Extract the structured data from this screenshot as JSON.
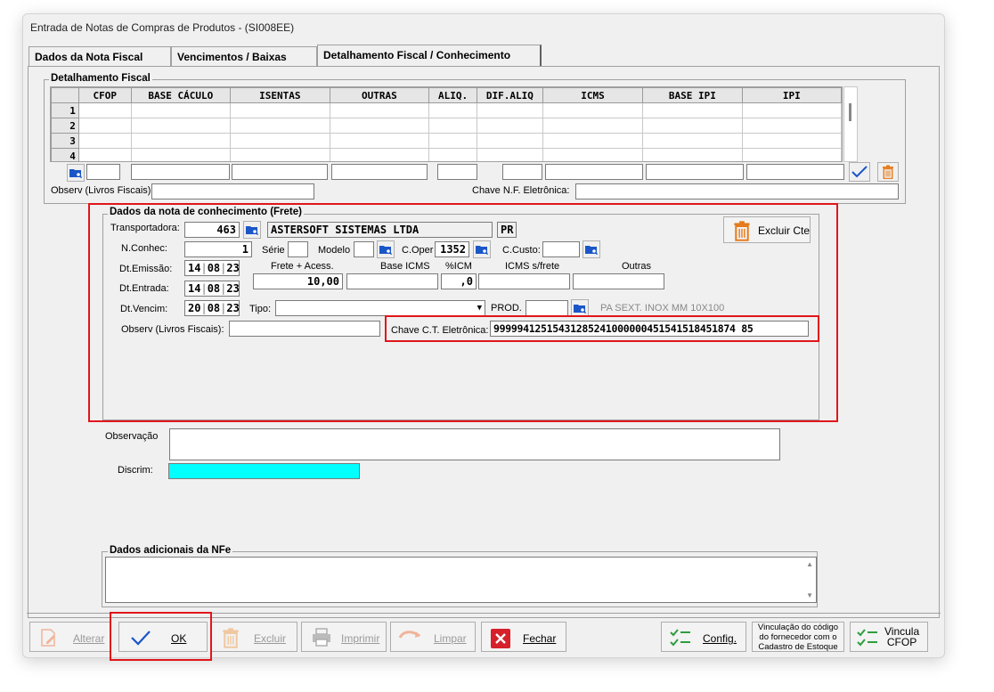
{
  "window": {
    "title": "Entrada de Notas de Compras de Produtos  - (SI008EE)"
  },
  "tabs": [
    {
      "label": "Dados da Nota Fiscal"
    },
    {
      "label": "Vencimentos / Baixas"
    },
    {
      "label": "Detalhamento Fiscal / Conhecimento"
    }
  ],
  "fiscal": {
    "legend": "Detalhamento Fiscal",
    "columns": [
      "CFOP",
      "BASE CÁCULO",
      "ISENTAS",
      "OUTRAS",
      "ALIQ.",
      "DIF.ALIQ",
      "ICMS",
      "BASE IPI",
      "IPI"
    ],
    "row_numbers": [
      "1",
      "2",
      "3",
      "4"
    ],
    "observ_label": "Observ (Livros Fiscais):",
    "chave_label": "Chave N.F. Eletrônica:"
  },
  "frete": {
    "legend": "Dados da nota de conhecimento (Frete)",
    "transportadora_label": "Transportadora:",
    "transportadora_code": "463",
    "transportadora_name": "ASTERSOFT SISTEMAS LTDA",
    "transportadora_uf": "PR",
    "excluir_cte_label": "Excluir Cte",
    "nconhec_label": "N.Conhec:",
    "nconhec_value": "1",
    "serie_label": "Série",
    "modelo_label": "Modelo",
    "coper_label": "C.Oper",
    "coper_value": "1352",
    "ccusto_label": "C.Custo:",
    "dt_emissao_label": "Dt.Emissão:",
    "dt_emissao": {
      "d": "14",
      "m": "08",
      "y": "23"
    },
    "dt_entrada_label": "Dt.Entrada:",
    "dt_entrada": {
      "d": "14",
      "m": "08",
      "y": "23"
    },
    "dt_vencim_label": "Dt.Vencim:",
    "dt_vencim": {
      "d": "20",
      "m": "08",
      "y": "23"
    },
    "frete_acess_label": "Frete + Acess.",
    "frete_acess_value": "10,00",
    "base_icms_label": "Base ICMS",
    "pct_icm_label": "%ICM",
    "pct_icm_value": ",0",
    "icms_sfrete_label": "ICMS s/frete",
    "outras_label": "Outras",
    "tipo_label": "Tipo:",
    "prod_label": "PROD.",
    "prod_desc": "PA SEXT. INOX MM 10X100",
    "observ_label": "Observ (Livros Fiscais):",
    "chave_cte_label": "Chave C.T. Eletrônica:",
    "chave_cte_value": "99999412515431285241000000451541518451874 85"
  },
  "observacao_label": "Observação",
  "discrim_label": "Discrim:",
  "nfe": {
    "legend": "Dados adicionais da NFe"
  },
  "buttons": {
    "alterar": "Alterar",
    "ok": "OK",
    "excluir": "Excluir",
    "imprimir": "Imprimir",
    "limpar": "Limpar",
    "fechar": "Fechar",
    "config": "Config.",
    "vinculacao": [
      "Vinculação do código",
      "do fornecedor com o",
      "Cadastro de Estoque"
    ],
    "vincula_cfop": [
      "Vincula",
      "CFOP"
    ]
  },
  "colors": {
    "highlight": "#e0161b",
    "discrim": "#00ffff",
    "accent_blue": "#1a56c8",
    "accent_orange": "#e57b1c",
    "accent_green": "#2e9e3e",
    "danger": "#d6202a"
  }
}
